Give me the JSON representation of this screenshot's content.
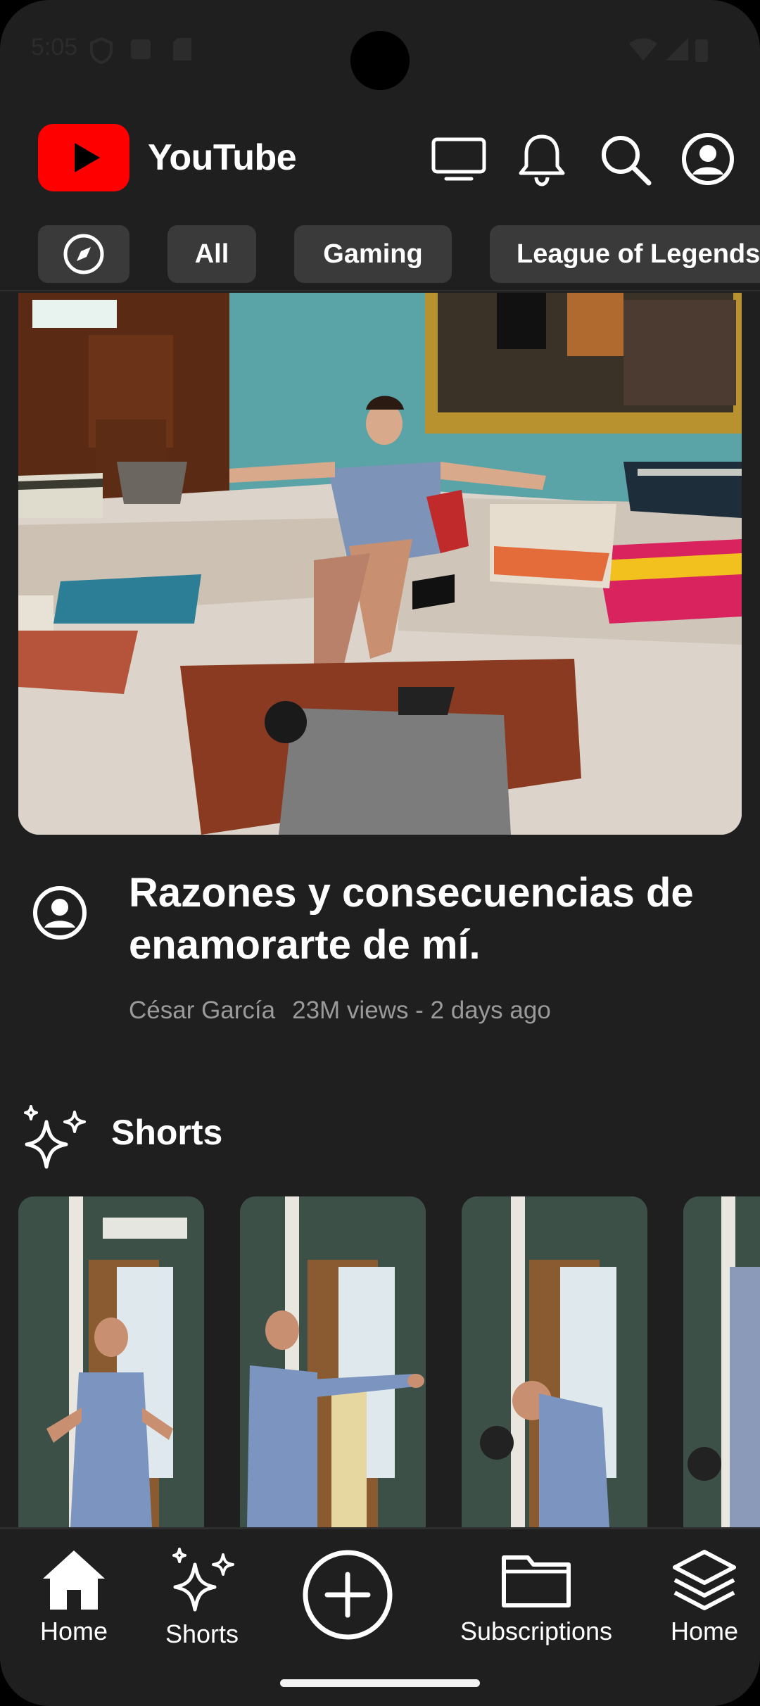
{
  "status_bar": {
    "time": "5:05"
  },
  "header": {
    "app_name": "YouTube",
    "icons": [
      "cast-tv-icon",
      "notifications-bell-icon",
      "search-icon",
      "account-icon"
    ]
  },
  "chips": [
    {
      "icon": "explore-compass-icon"
    },
    {
      "label": "All"
    },
    {
      "label": "Gaming"
    },
    {
      "label": "League of Legends"
    }
  ],
  "video": {
    "title": "Razones y consecuencias de enamorarte de mí.",
    "channel": "César García",
    "stats": "23M views - 2 days ago"
  },
  "shorts": {
    "heading": "Shorts",
    "count_visible": 4
  },
  "bottom_nav": {
    "items": [
      {
        "label": "Home",
        "icon": "home-icon"
      },
      {
        "label": "Shorts",
        "icon": "shorts-sparkle-icon"
      },
      {
        "label": "",
        "icon": "create-plus-icon"
      },
      {
        "label": "Subscriptions",
        "icon": "folder-icon"
      },
      {
        "label": "Home",
        "icon": "layers-icon"
      }
    ]
  },
  "colors": {
    "brand_red": "#ff0000",
    "background": "#1f1f1f",
    "chip": "#3a3a3a",
    "meta_text": "#9a9a9a"
  }
}
